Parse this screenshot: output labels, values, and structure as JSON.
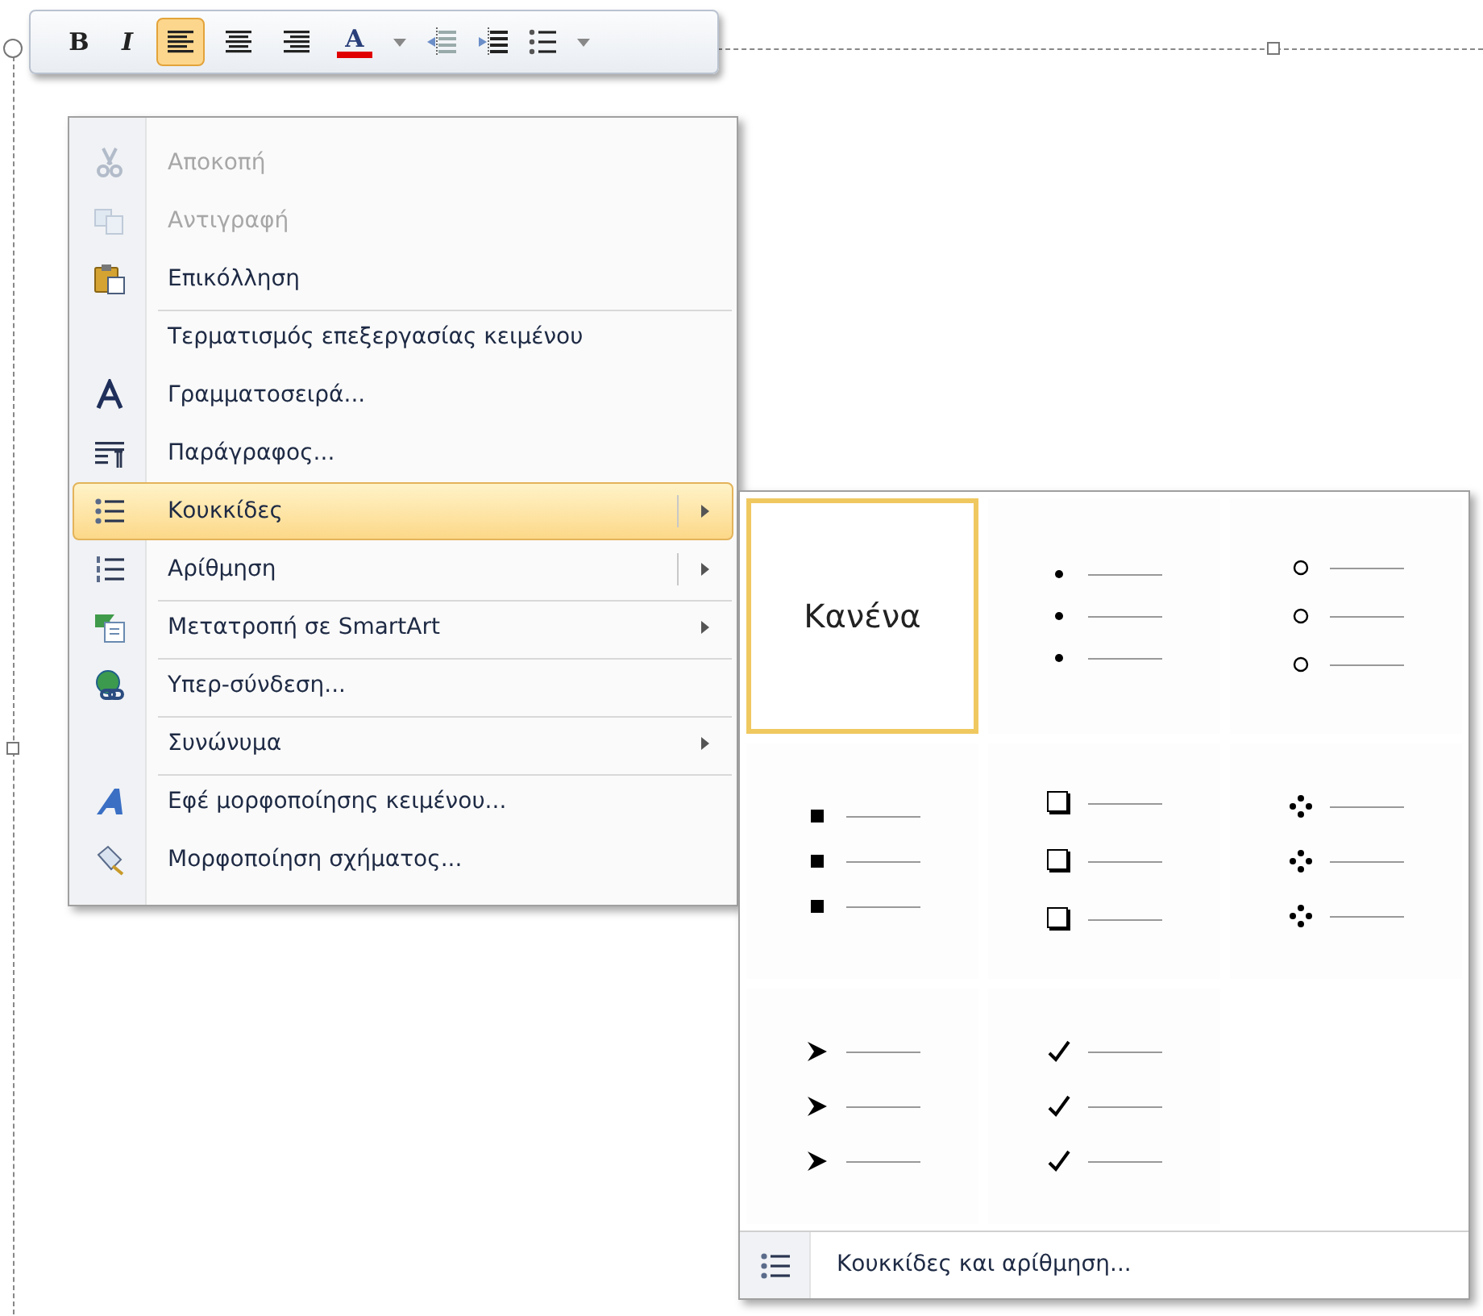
{
  "mini_toolbar": {
    "buttons": [
      {
        "kind": "bold",
        "text": "B",
        "selected": false
      },
      {
        "kind": "italic",
        "text": "I",
        "selected": false
      },
      {
        "kind": "align-left",
        "selected": true
      },
      {
        "kind": "align-center",
        "selected": false
      },
      {
        "kind": "align-right",
        "selected": false
      },
      {
        "kind": "font-color",
        "text": "A",
        "selected": false
      },
      {
        "kind": "dropdown",
        "selected": false
      },
      {
        "kind": "outdent",
        "selected": false
      },
      {
        "kind": "indent",
        "selected": false
      },
      {
        "kind": "bullets",
        "selected": false
      },
      {
        "kind": "dropdown",
        "selected": false
      }
    ]
  },
  "context_menu": {
    "items": [
      {
        "kind": "scissors",
        "label": "Αποκοπή",
        "disabled": true,
        "submenu": false,
        "selected": false,
        "separator_before": false
      },
      {
        "kind": "copy",
        "label": "Αντιγραφή",
        "disabled": true,
        "submenu": false,
        "selected": false,
        "separator_before": false
      },
      {
        "kind": "paste",
        "label": "Επικόλληση",
        "disabled": false,
        "submenu": false,
        "selected": false,
        "separator_before": false
      },
      {
        "kind": "plain",
        "label": "Τερματισμός επεξεργασίας κειμένου",
        "disabled": false,
        "submenu": false,
        "selected": false,
        "separator_before": true
      },
      {
        "kind": "font",
        "label": "Γραμματοσειρά...",
        "disabled": false,
        "submenu": false,
        "selected": false,
        "separator_before": false
      },
      {
        "kind": "paragraph",
        "label": "Παράγραφος...",
        "disabled": false,
        "submenu": false,
        "selected": false,
        "separator_before": false
      },
      {
        "kind": "bullets",
        "label": "Κουκκίδες",
        "disabled": false,
        "submenu": true,
        "split": true,
        "selected": true,
        "separator_before": false
      },
      {
        "kind": "numbering",
        "label": "Αρίθμηση",
        "disabled": false,
        "submenu": true,
        "split": true,
        "selected": false,
        "separator_before": false
      },
      {
        "kind": "smartart",
        "label": "Μετατροπή σε SmartArt",
        "disabled": false,
        "submenu": true,
        "split": false,
        "selected": false,
        "separator_before": true
      },
      {
        "kind": "hyperlink",
        "label": "Υπερ-σύνδεση...",
        "disabled": false,
        "submenu": false,
        "selected": false,
        "separator_before": true
      },
      {
        "kind": "plain",
        "label": "Συνώνυμα",
        "disabled": false,
        "submenu": true,
        "split": false,
        "selected": false,
        "separator_before": true
      },
      {
        "kind": "wordart",
        "label": "Εφέ μορφοποίησης κειμένου...",
        "disabled": false,
        "submenu": false,
        "selected": false,
        "separator_before": true
      },
      {
        "kind": "format-shape",
        "label": "Μορφοποίηση σχήματος...",
        "disabled": false,
        "submenu": false,
        "selected": false,
        "separator_before": false
      }
    ]
  },
  "bullet_gallery": {
    "items": [
      {
        "kind": "none",
        "label": "Κανένα",
        "selected": true
      },
      {
        "kind": "dot",
        "selected": false
      },
      {
        "kind": "circle",
        "selected": false
      },
      {
        "kind": "square",
        "selected": false
      },
      {
        "kind": "box",
        "selected": false
      },
      {
        "kind": "diamond",
        "selected": false
      },
      {
        "kind": "arrow",
        "selected": false
      },
      {
        "kind": "check",
        "selected": false
      }
    ],
    "footer": {
      "label": "Κουκκίδες και αρίθμηση..."
    }
  }
}
